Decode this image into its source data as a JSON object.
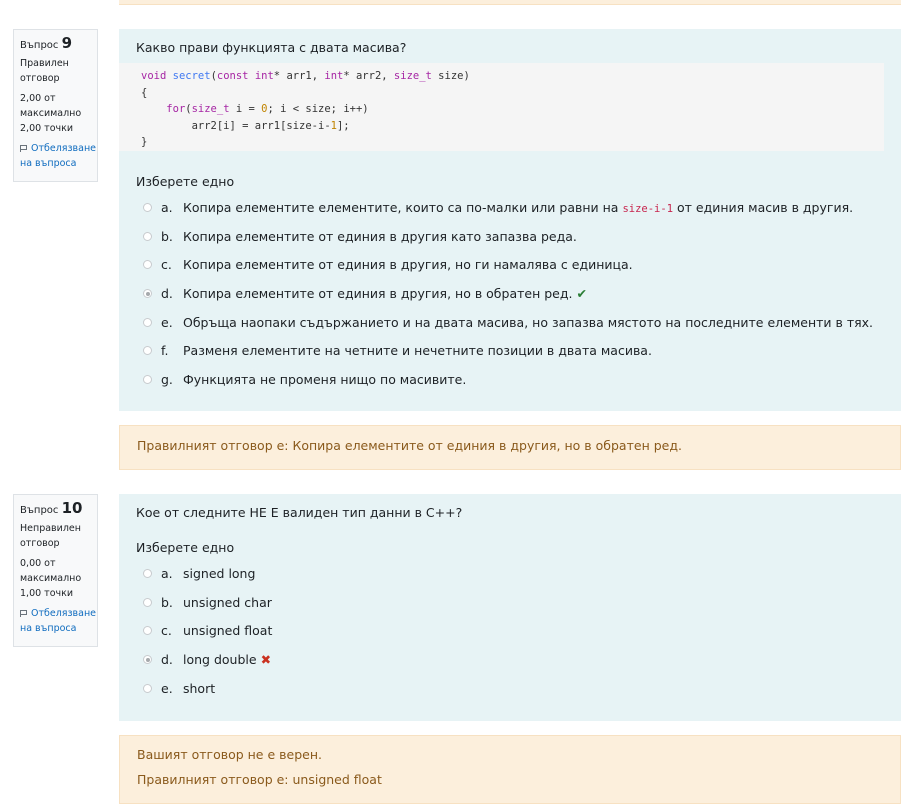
{
  "q9": {
    "label": "Въпрос",
    "number": "9",
    "state_line1": "Правилен",
    "state_line2": "отговор",
    "grade_line1": "2,00 от",
    "grade_line2": "максимално",
    "grade_line3": "2,00 точки",
    "flag_line1": "Отбелязване",
    "flag_line2": "на въпроса",
    "text": "Какво прави функцията с двата масива?",
    "prompt": "Изберете едно",
    "answers": [
      {
        "letter": "a.",
        "pre": "Копира елементите елементите, които са по-малки или равни на ",
        "code": "size-i-1",
        "post": " от единия масив в другия."
      },
      {
        "letter": "b.",
        "text": "Копира елементите от единия в другия като запазва реда."
      },
      {
        "letter": "c.",
        "text": "Копира елементите от единия в другия, но ги намалява с единица."
      },
      {
        "letter": "d.",
        "text": "Копира елементите от единия в другия, но в обратен ред.",
        "selected": true,
        "result": "correct"
      },
      {
        "letter": "e.",
        "text": "Обръща наопаки съдържанието и на двата масива, но запазва мястото на последните елементи в тях."
      },
      {
        "letter": "f.",
        "text": "Разменя елементите на четните и нечетните позиции в двата масива."
      },
      {
        "letter": "g.",
        "text": "Функцията не променя нищо по масивите."
      }
    ],
    "feedback": "Правилният отговор е: Копира елементите от единия в другия, но в обратен ред."
  },
  "q10": {
    "label": "Въпрос",
    "number": "10",
    "state_line1": "Неправилен",
    "state_line2": "отговор",
    "grade_line1": "0,00 от",
    "grade_line2": "максимално",
    "grade_line3": "1,00 точки",
    "flag_line1": "Отбелязване",
    "flag_line2": "на въпроса",
    "text": "Кое от следните НЕ Е валиден тип данни в С++?",
    "prompt": "Изберете едно",
    "answers": [
      {
        "letter": "a.",
        "text": "signed long"
      },
      {
        "letter": "b.",
        "text": "unsigned char"
      },
      {
        "letter": "c.",
        "text": "unsigned float"
      },
      {
        "letter": "d.",
        "text": "long double",
        "selected": true,
        "result": "incorrect"
      },
      {
        "letter": "e.",
        "text": "short"
      }
    ],
    "feedback_line1": "Вашият отговор не е верен.",
    "feedback_line2": "Правилният отговор е: unsigned float"
  },
  "marks": {
    "correct": "✔",
    "incorrect": "✖"
  },
  "colors": {
    "correct": "#2a7d35",
    "incorrect": "#ca3120",
    "link": "#0f6cbf",
    "formulation_bg": "#e7f3f5",
    "feedback_bg": "#fcefdc"
  },
  "code": {
    "l1": {
      "t1": "void",
      "t2": "secret",
      "t3": "(",
      "t4": "const int",
      "t5": "* arr1, ",
      "t6": "int",
      "t7": "* arr2, ",
      "t8": "size_t",
      "t9": " size)"
    },
    "l2": "{",
    "l3": {
      "t1": "    ",
      "t2": "for",
      "t3": "(",
      "t4": "size_t",
      "t5": " i = ",
      "t6": "0",
      "t7": "; i < size; i++)"
    },
    "l4": {
      "t1": "        arr2[i] = arr1[size-i-",
      "t2": "1",
      "t3": "];"
    },
    "l5": "}"
  }
}
